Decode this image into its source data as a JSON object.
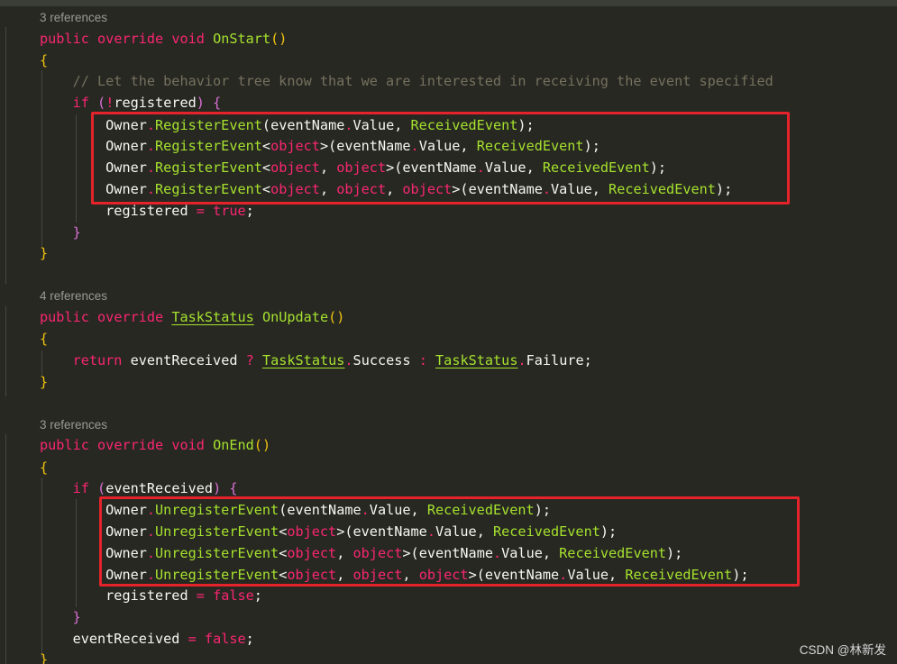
{
  "lenses": [
    "3 references",
    "4 references",
    "3 references"
  ],
  "code": {
    "public": "public",
    "override": "override",
    "void": "void",
    "on_start": "OnStart",
    "on_update": "OnUpdate",
    "on_end": "OnEnd",
    "task_status": "TaskStatus",
    "comment": "// Let the behavior tree know that we are interested in receiving the event specified",
    "if_kw": "if",
    "return_kw": "return",
    "owner": "Owner",
    "register_event": "RegisterEvent",
    "unregister_event": "UnregisterEvent",
    "object_kw": "object",
    "event_name": "eventName",
    "value": "Value",
    "received_event": "ReceivedEvent",
    "registered": "registered",
    "event_received": "eventReceived",
    "true_kw": "true",
    "false_kw": "false",
    "success": "Success",
    "failure": "Failure"
  },
  "watermark": "CSDN @林新发",
  "highlight_color": "#e4232b"
}
